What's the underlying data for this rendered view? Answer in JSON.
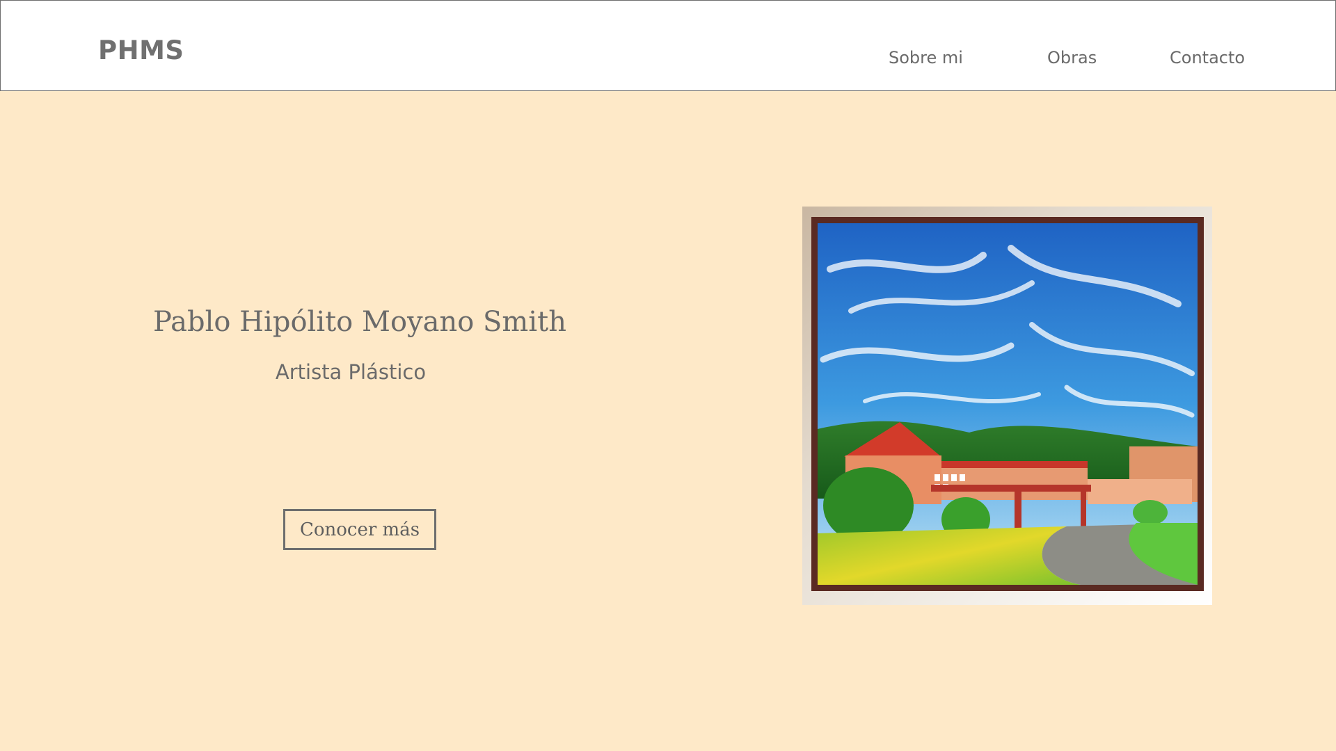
{
  "header": {
    "logo": "PHMS",
    "nav": [
      {
        "label": "Sobre mi"
      },
      {
        "label": "Obras"
      },
      {
        "label": "Contacto"
      }
    ]
  },
  "hero": {
    "name": "Pablo Hipólito Moyano Smith",
    "role": "Artista Plástico",
    "cta_label": "Conocer más"
  },
  "colors": {
    "page_background": "#fee9c8",
    "header_background": "#ffffff",
    "text": "#6a6a6a"
  }
}
